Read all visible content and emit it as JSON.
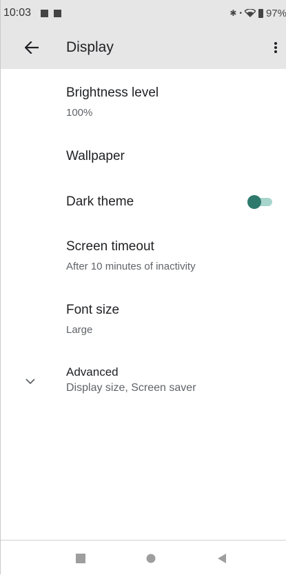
{
  "status_bar": {
    "time": "10:03",
    "battery_percent": "97%"
  },
  "app_bar": {
    "title": "Display"
  },
  "settings": {
    "brightness": {
      "title": "Brightness level",
      "summary": "100%"
    },
    "wallpaper": {
      "title": "Wallpaper"
    },
    "dark_theme": {
      "title": "Dark theme",
      "enabled": true
    },
    "screen_timeout": {
      "title": "Screen timeout",
      "summary": "After 10 minutes of inactivity"
    },
    "font_size": {
      "title": "Font size",
      "summary": "Large"
    },
    "advanced": {
      "title": "Advanced",
      "summary": "Display size, Screen saver"
    }
  },
  "icons": {
    "back": "arrow-left-icon",
    "overflow": "more-vert-icon",
    "chevron": "chevron-down-icon",
    "nav_recents": "square-icon",
    "nav_home": "circle-icon",
    "nav_back": "triangle-icon"
  },
  "colors": {
    "app_bar_bg": "#e6e6e6",
    "toggle_thumb": "#2e7a6d",
    "toggle_track": "#a7d5cc",
    "nav_icon": "#9e9e9e"
  }
}
